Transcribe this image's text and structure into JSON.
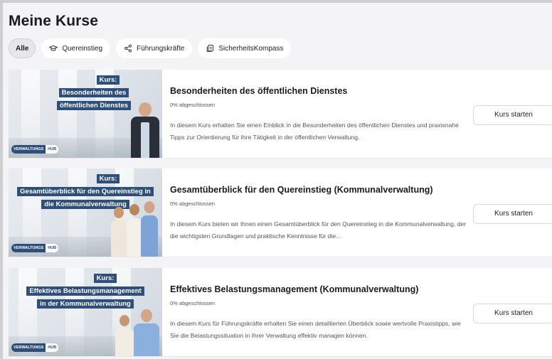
{
  "page": {
    "title": "Meine Kurse"
  },
  "filters": [
    {
      "label": "Alle",
      "icon": "",
      "active": true
    },
    {
      "label": "Quereinstieg",
      "icon": "graduation-cap-icon",
      "active": false
    },
    {
      "label": "Führungskräfte",
      "icon": "share-nodes-icon",
      "active": false
    },
    {
      "label": "SicherheitsKompass",
      "icon": "document-copy-icon",
      "active": false
    }
  ],
  "brand": {
    "part1": "VERWALTUNGS",
    "part2": "HUB",
    "color": "#2e4f7a"
  },
  "courses": [
    {
      "thumb_lines": [
        "Kurs:",
        "Besonderheiten des",
        "öffentlichen Dienstes"
      ],
      "title": "Besonderheiten des öffentlichen Dienstes",
      "progress": "0% abgeschlossen",
      "description": "In diesem Kurs erhalten Sie einen Einblick in die Besonderheiten des öffentlichen Dienstes und praxisnahe Tipps zur Orientierung für Ihre Tätigkeit in der öffentlichen Verwaltung.",
      "button": "Kurs starten"
    },
    {
      "thumb_lines": [
        "Kurs:",
        "Gesamtüberblick für den Quereinstieg in",
        "die Kommunalverwaltung"
      ],
      "title": "Gesamtüberblick für den Quereinstieg (Kommunalverwaltung)",
      "progress": "0% abgeschlossen",
      "description": "In diesem Kurs bieten wir Ihnen einen Gesamtüberblick für den Quereinstieg in die Kommunalverwaltung, der die wichtigsten Grundlagen und praktische Kenntnisse für die…",
      "button": "Kurs starten"
    },
    {
      "thumb_lines": [
        "Kurs:",
        "Effektives Belastungsmanagement",
        "in der Kommunalverwaltung"
      ],
      "title": "Effektives Belastungsmanagement (Kommunalverwaltung)",
      "progress": "0% abgeschlossen",
      "description": "In diesem Kurs für Führungskräfte erhalten Sie einen detaillierten Überblick sowie wertvolle Praxistipps, wie Sie die Belastungssituation in Ihrer Verwaltung effektiv managen können.",
      "button": "Kurs starten"
    }
  ]
}
